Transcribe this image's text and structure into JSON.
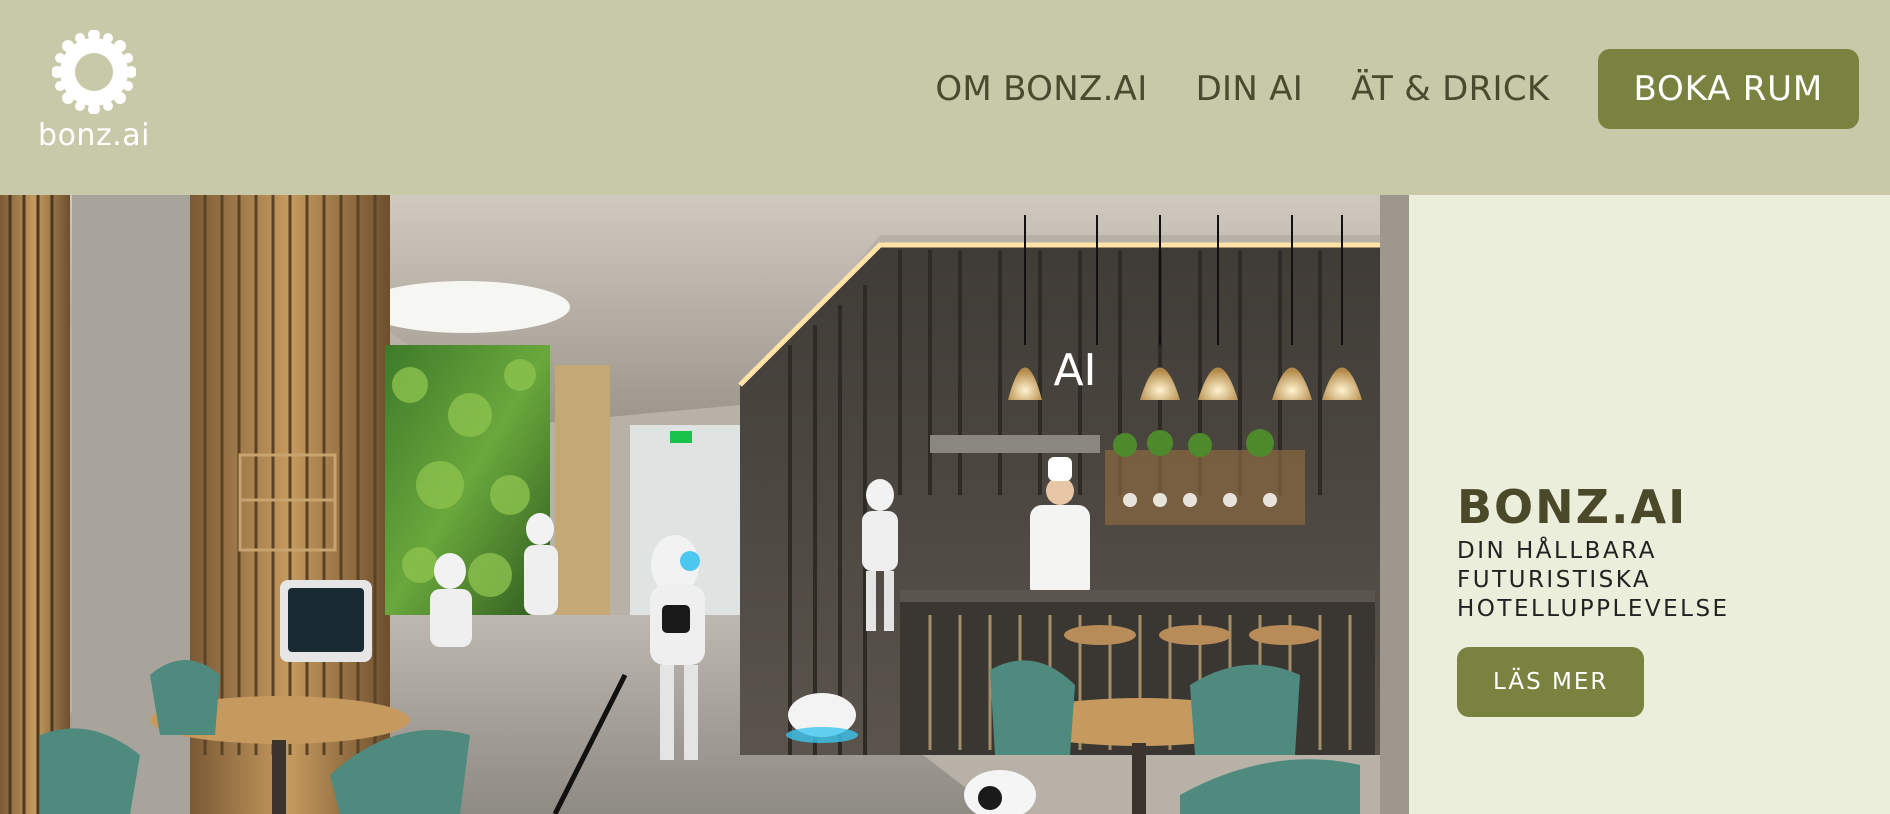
{
  "brand": {
    "logo_text": "bonz.ai",
    "logo_icon": "sun-flower-icon"
  },
  "nav": {
    "items": [
      {
        "label": "OM BONZ.AI"
      },
      {
        "label": "DIN AI"
      },
      {
        "label": "ÄT & DRICK"
      }
    ],
    "cta_label": "BOKA RUM"
  },
  "hero": {
    "image_text": "AI",
    "title": "BONZ.AI",
    "subtitle_lines": [
      "DIN HÅLLBARA",
      "FUTURISTISKA",
      "HOTELLUPPLEVELSE"
    ],
    "button_label": "LÄS MER"
  },
  "colors": {
    "header_bg": "#c8c9a8",
    "accent": "#7a8240",
    "side_bg": "#ebeeda",
    "nav_text": "#4a4a30"
  }
}
